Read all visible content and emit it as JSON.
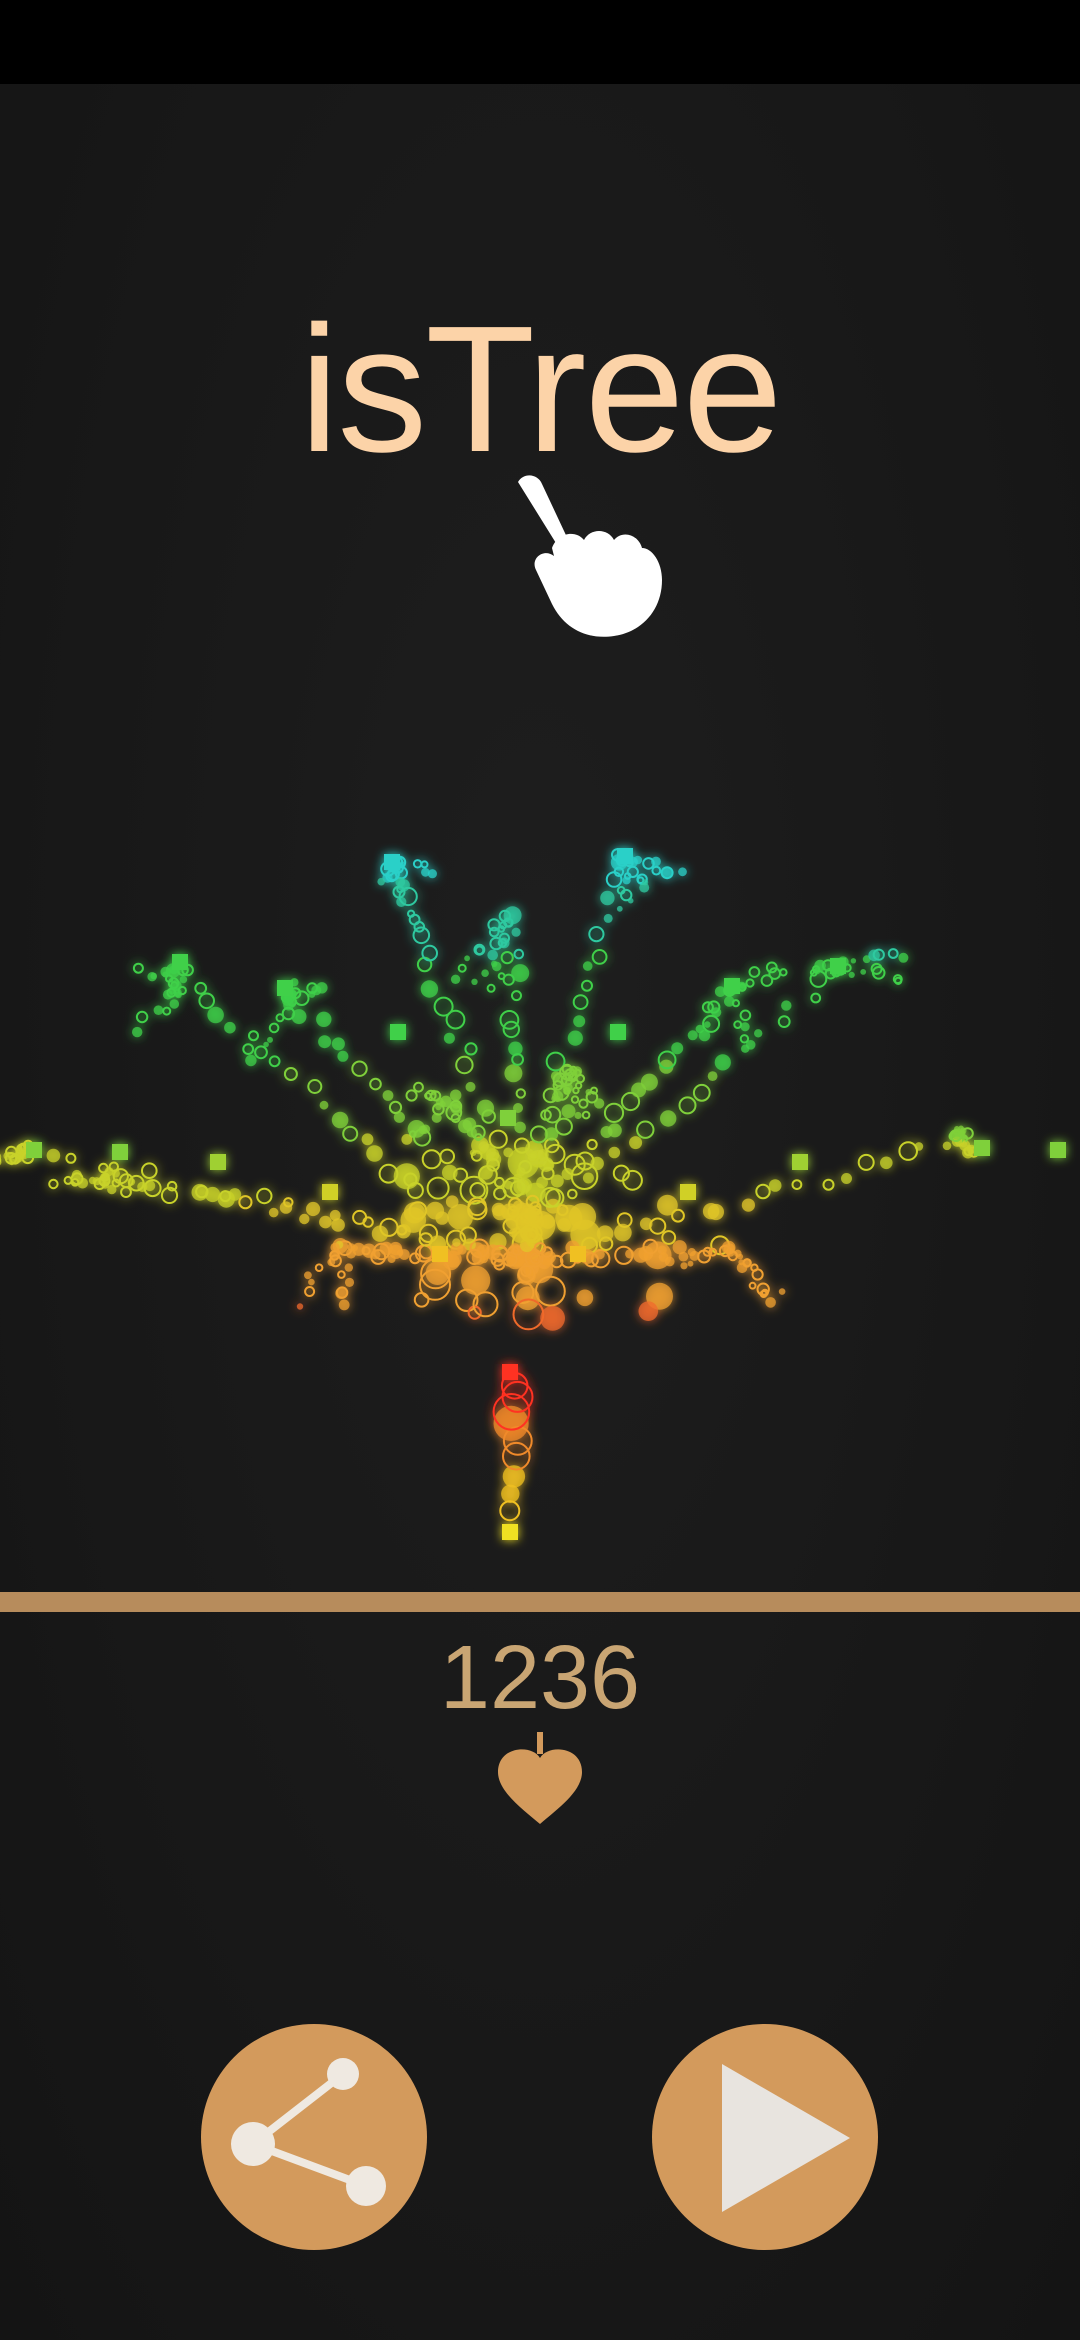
{
  "app": {
    "title": "isTree"
  },
  "game": {
    "score": "1236"
  },
  "icons": {
    "tap_hint": "pointing-hand-icon",
    "score_unit": "seed-icon",
    "share": "share-icon",
    "play": "play-icon"
  },
  "colors": {
    "title": "#fcd3a8",
    "accent": "#d39a5c",
    "ground": "#b78c5c",
    "score": "#c9a573",
    "background": "#1a1a1a"
  }
}
